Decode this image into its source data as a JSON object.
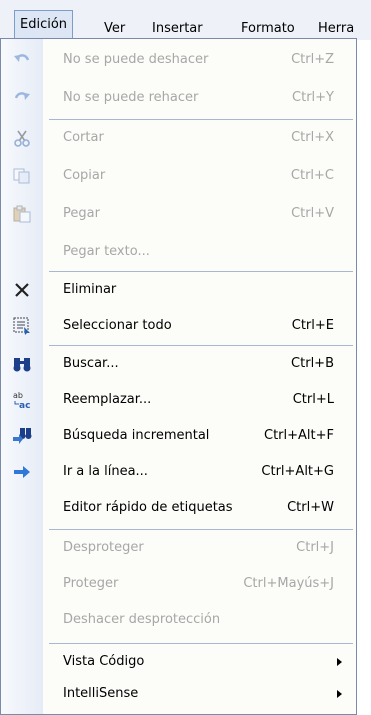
{
  "menubar": {
    "items": [
      "Edición",
      "Ver",
      "Insertar",
      "Formato",
      "Herra"
    ]
  },
  "menu": {
    "items": [
      {
        "label": "No se puede deshacer",
        "shortcut": "Ctrl+Z",
        "icon": "undo-icon",
        "enabled": false
      },
      {
        "label": "No se puede rehacer",
        "shortcut": "Ctrl+Y",
        "icon": "redo-icon",
        "enabled": false
      },
      {
        "label": "Cortar",
        "shortcut": "Ctrl+X",
        "icon": "scissors-icon",
        "enabled": false
      },
      {
        "label": "Copiar",
        "shortcut": "Ctrl+C",
        "icon": "copy-icon",
        "enabled": false
      },
      {
        "label": "Pegar",
        "shortcut": "Ctrl+V",
        "icon": "paste-icon",
        "enabled": false
      },
      {
        "label": "Pegar texto...",
        "shortcut": "",
        "icon": "",
        "enabled": false
      },
      {
        "label": "Eliminar",
        "shortcut": "",
        "icon": "delete-x-icon",
        "enabled": true
      },
      {
        "label": "Seleccionar todo",
        "shortcut": "Ctrl+E",
        "icon": "select-all-icon",
        "enabled": true
      },
      {
        "label": "Buscar...",
        "shortcut": "Ctrl+B",
        "icon": "binoculars-icon",
        "enabled": true
      },
      {
        "label": "Reemplazar...",
        "shortcut": "Ctrl+L",
        "icon": "replace-icon",
        "enabled": true
      },
      {
        "label": "Búsqueda incremental",
        "shortcut": "Ctrl+Alt+F",
        "icon": "incremental-search-icon",
        "enabled": true
      },
      {
        "label": "Ir a la línea...",
        "shortcut": "Ctrl+Alt+G",
        "icon": "arrow-right-icon",
        "enabled": true
      },
      {
        "label": "Editor rápido de etiquetas",
        "shortcut": "Ctrl+W",
        "icon": "",
        "enabled": true
      },
      {
        "label": "Desproteger",
        "shortcut": "Ctrl+J",
        "icon": "",
        "enabled": false
      },
      {
        "label": "Proteger",
        "shortcut": "Ctrl+Mayús+J",
        "icon": "",
        "enabled": false
      },
      {
        "label": "Deshacer desprotección",
        "shortcut": "",
        "icon": "",
        "enabled": false
      },
      {
        "label": "Vista Código",
        "shortcut": "",
        "icon": "",
        "enabled": true,
        "submenu": true
      },
      {
        "label": "IntelliSense",
        "shortcut": "",
        "icon": "",
        "enabled": true,
        "submenu": true
      }
    ]
  },
  "colors": {
    "disabled_text": "#a7a7a7",
    "menu_border": "#7a8aa8",
    "separator": "#a9b8d2",
    "active_menu_bg": "#dce6f4"
  }
}
